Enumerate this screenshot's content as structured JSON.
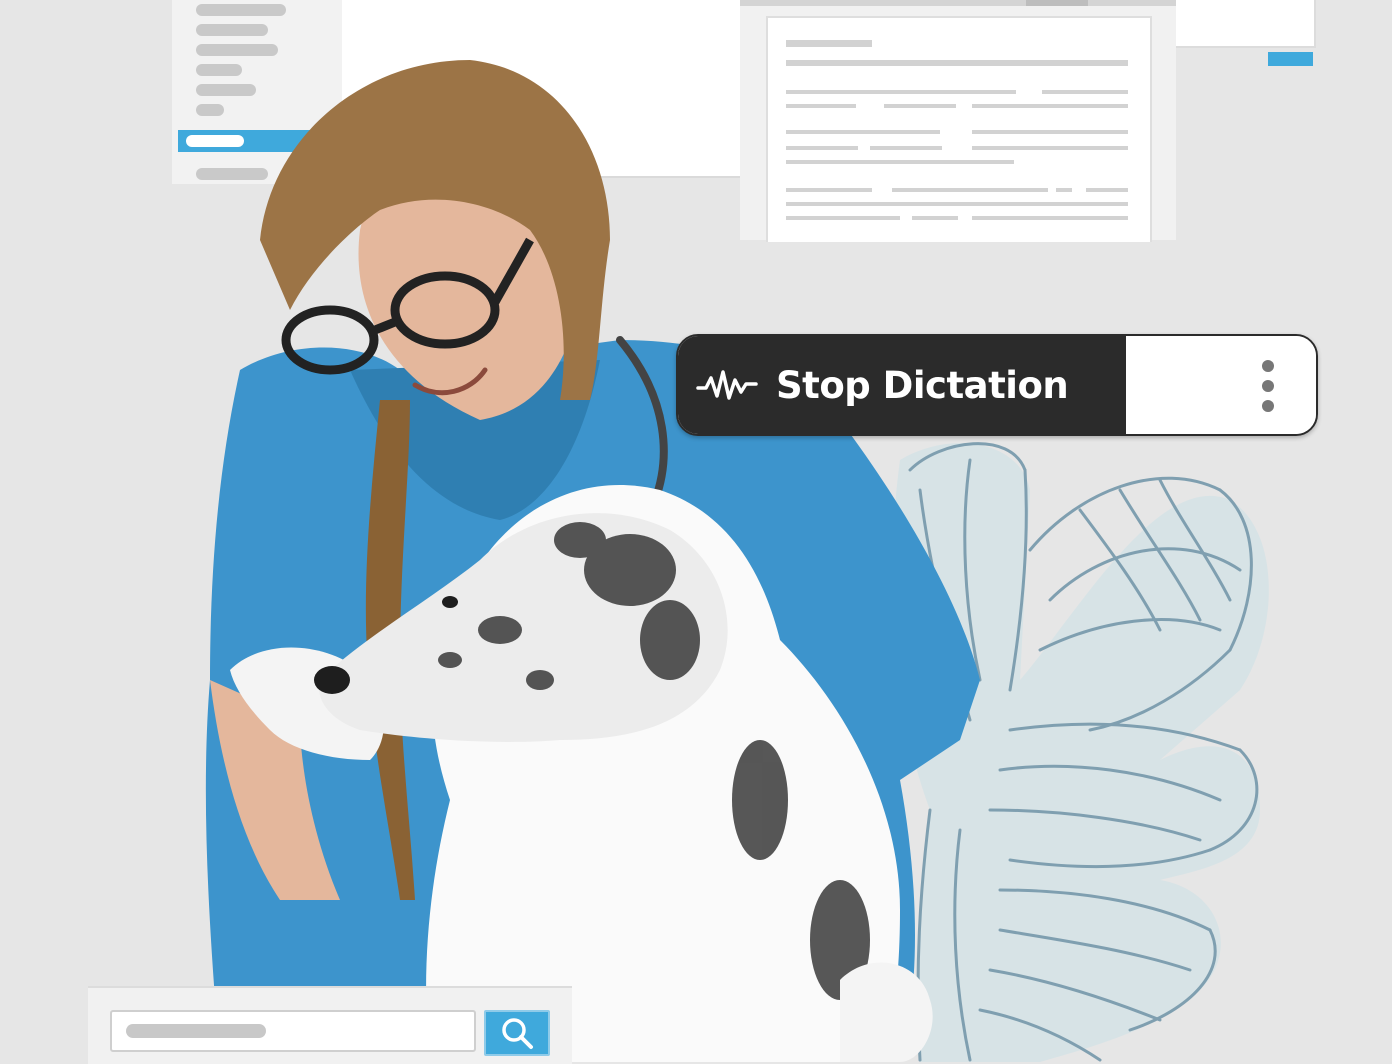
{
  "dictation_bar": {
    "label": "Stop Dictation",
    "icon": "waveform-icon",
    "menu_icon": "kebab-menu-icon"
  },
  "search": {
    "icon": "search-icon"
  },
  "colors": {
    "accent_blue": "#3fa9dc",
    "bar_dark": "#2b2b2b",
    "background": "#e6e6e6",
    "leaf_stroke": "#7f9fb0",
    "leaf_fill": "#d3e2e6",
    "scrubs": "#3d94cc"
  }
}
